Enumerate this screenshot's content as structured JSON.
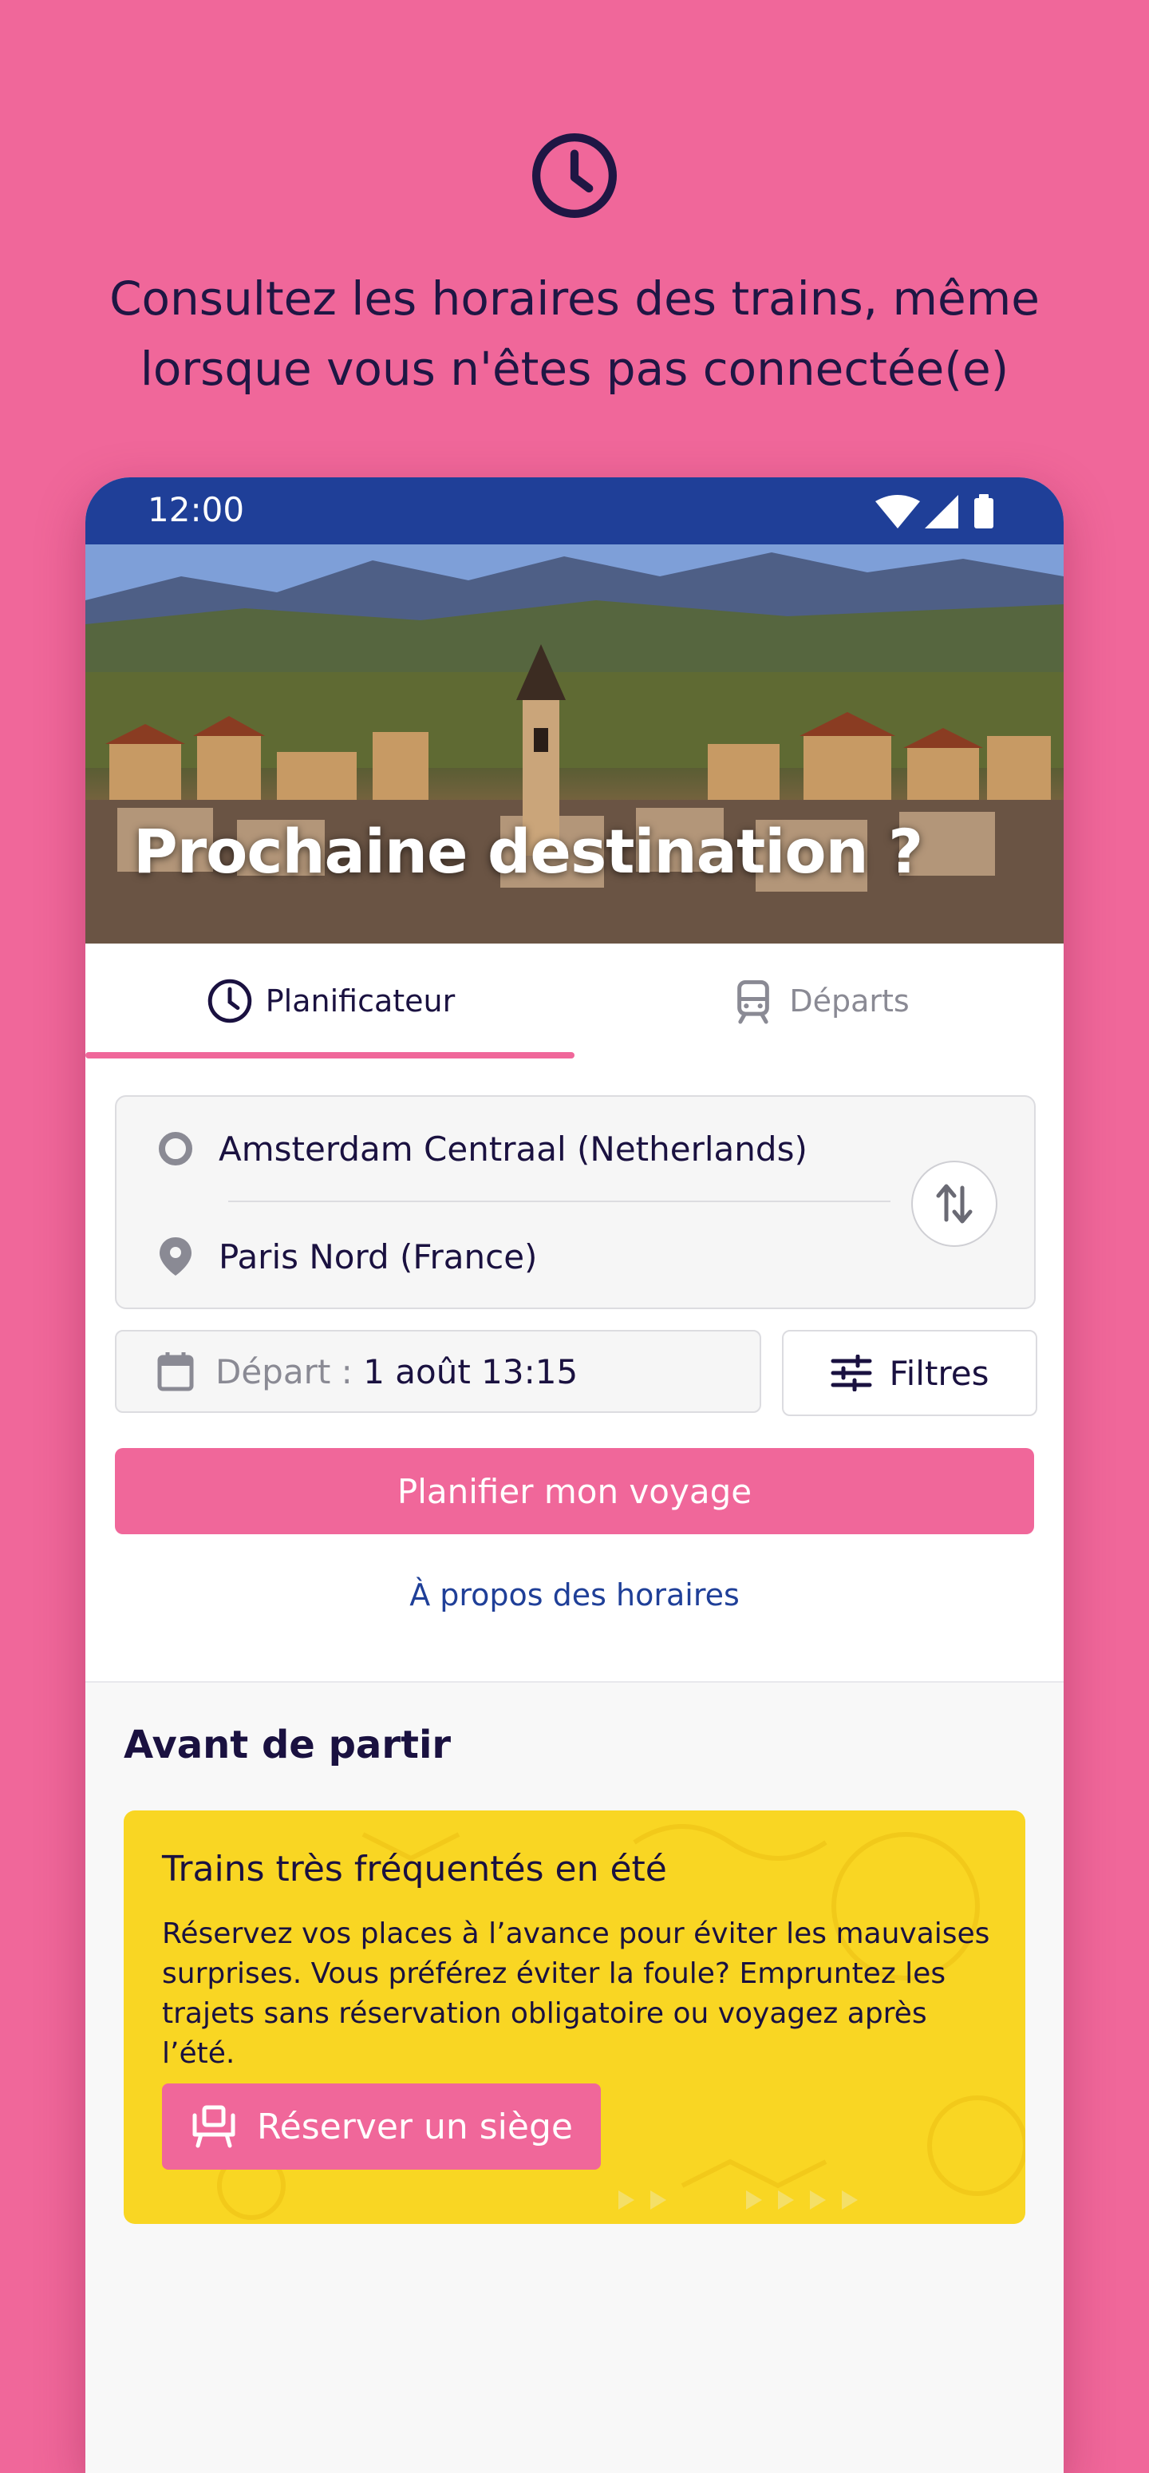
{
  "promo_headline": "Consultez les horaires des trains, même lorsque vous n'êtes pas connectée(e)",
  "status": {
    "time": "12:00"
  },
  "hero": {
    "title": "Prochaine destination ?"
  },
  "tabs": [
    {
      "label": "Planificateur",
      "icon": "clock-icon"
    },
    {
      "label": "Départs",
      "icon": "train-icon"
    }
  ],
  "route": {
    "from": "Amsterdam Centraal (Netherlands)",
    "to": "Paris Nord (France)"
  },
  "date": {
    "label": "Départ :",
    "value": "1 août 13:15"
  },
  "filters_label": "Filtres",
  "plan_button": "Planifier mon voyage",
  "about_link": "À propos des horaires",
  "section": {
    "title": "Avant de partir",
    "card": {
      "title": "Trains très fréquentés en été",
      "text": "Réservez vos places à l’avance pour éviter les mauvaises surprises. Vous préférez éviter la foule? Empruntez les trajets sans réservation obligatoire ou voyagez après l’été.",
      "button": "Réserver un siège"
    }
  },
  "colors": {
    "accent": "#f0679a",
    "navy": "#1f3f98",
    "yellow": "#f9d623"
  }
}
